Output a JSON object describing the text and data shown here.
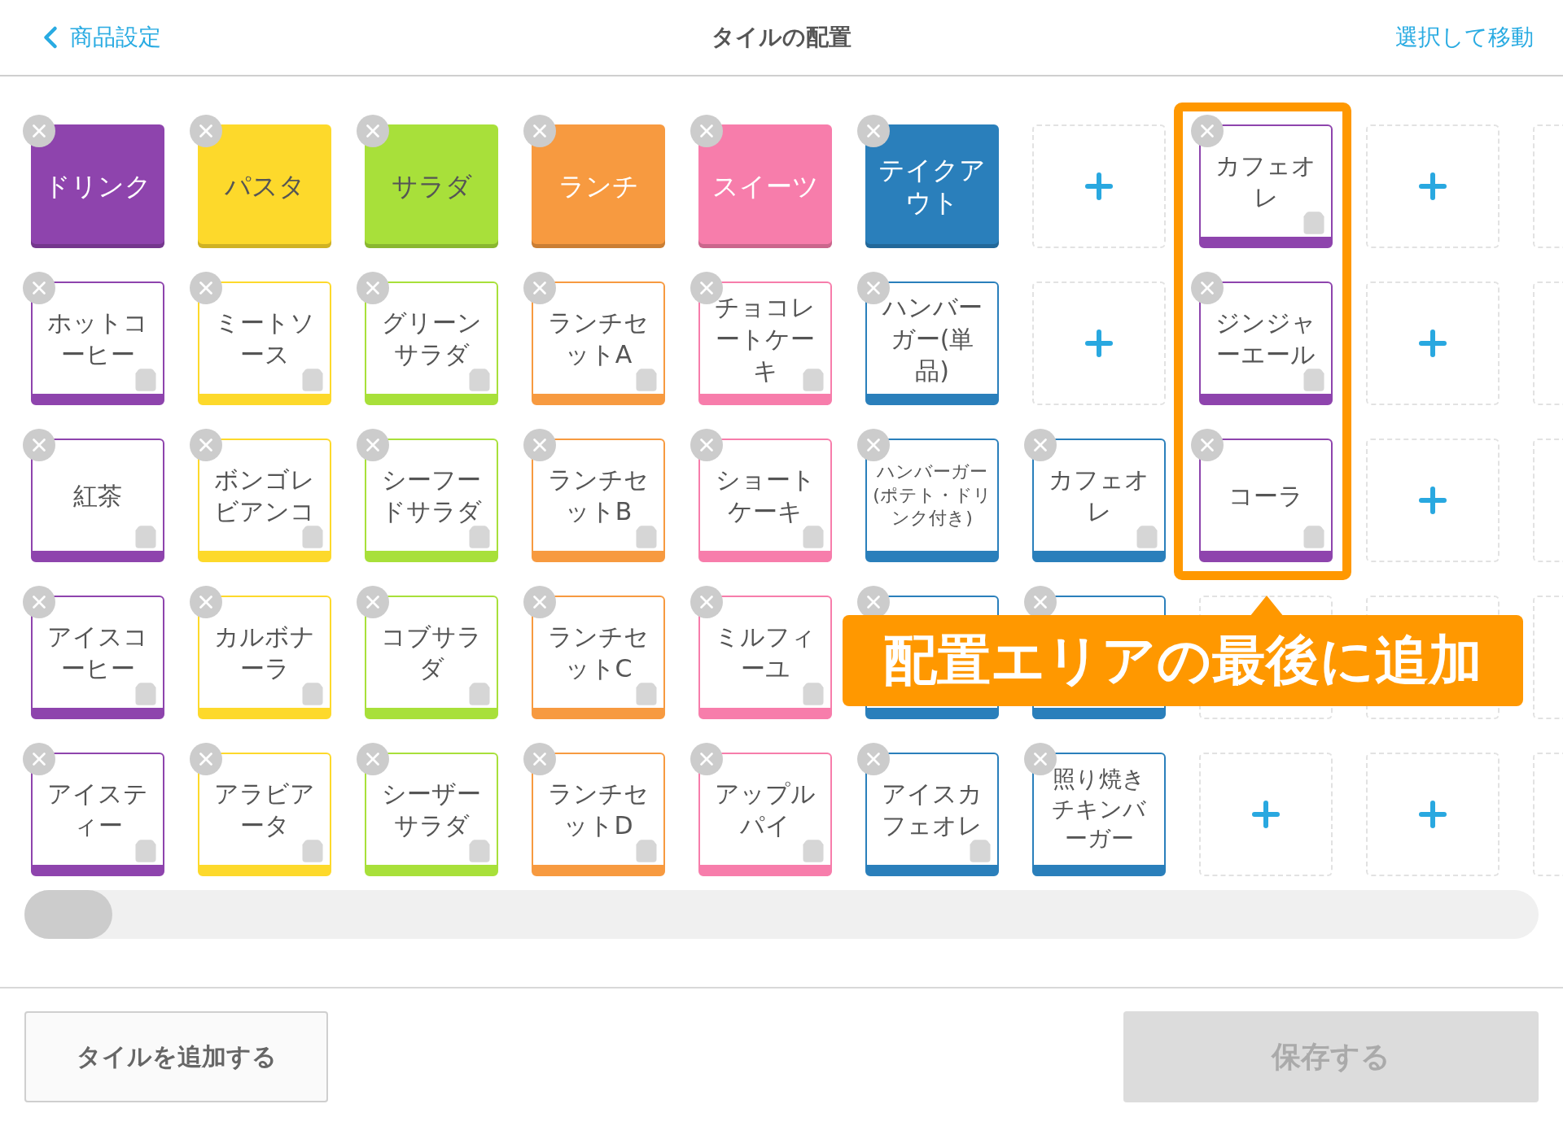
{
  "header": {
    "back_label": "商品設定",
    "title": "タイルの配置",
    "action": "選択して移動"
  },
  "grid": [
    {
      "cells": [
        {
          "kind": "category",
          "label": "ドリンク",
          "color": "#8e44ad"
        },
        {
          "kind": "category",
          "label": "パスタ",
          "color": "#fdd92b"
        },
        {
          "kind": "category",
          "label": "サラダ",
          "color": "#a8e03a"
        },
        {
          "kind": "category",
          "label": "ランチ",
          "color": "#f79a40"
        },
        {
          "kind": "category",
          "label": "スイーツ",
          "color": "#f77dab"
        },
        {
          "kind": "category",
          "label": "テイクアウト",
          "color": "#2a7fbb"
        },
        {
          "kind": "add"
        },
        {
          "kind": "item",
          "label": "カフェオレ",
          "color": "#8e44ad",
          "bag": true
        },
        {
          "kind": "add"
        },
        {
          "kind": "empty"
        }
      ]
    },
    {
      "cells": [
        {
          "kind": "item",
          "label": "ホットコーヒー",
          "color": "#8e44ad",
          "bag": true
        },
        {
          "kind": "item",
          "label": "ミートソース",
          "color": "#fdd92b",
          "bag": true
        },
        {
          "kind": "item",
          "label": "グリーンサラダ",
          "color": "#a8e03a",
          "bag": true
        },
        {
          "kind": "item",
          "label": "ランチセットA",
          "color": "#f79a40",
          "bag": true
        },
        {
          "kind": "item",
          "label": "チョコレートケーキ",
          "color": "#f77dab",
          "bag": true
        },
        {
          "kind": "item",
          "label": "ハンバーガー(単品)",
          "color": "#2a7fbb",
          "bag": false
        },
        {
          "kind": "add"
        },
        {
          "kind": "item",
          "label": "ジンジャーエール",
          "color": "#8e44ad",
          "bag": true
        },
        {
          "kind": "add"
        },
        {
          "kind": "empty"
        }
      ]
    },
    {
      "cells": [
        {
          "kind": "item",
          "label": "紅茶",
          "color": "#8e44ad",
          "bag": true
        },
        {
          "kind": "item",
          "label": "ボンゴレビアンコ",
          "color": "#fdd92b",
          "bag": true
        },
        {
          "kind": "item",
          "label": "シーフードサラダ",
          "color": "#a8e03a",
          "bag": true
        },
        {
          "kind": "item",
          "label": "ランチセットB",
          "color": "#f79a40",
          "bag": true
        },
        {
          "kind": "item",
          "label": "ショートケーキ",
          "color": "#f77dab",
          "bag": true
        },
        {
          "kind": "item",
          "label": "ハンバーガー(ポテト・ドリンク付き)",
          "color": "#2a7fbb",
          "bag": false
        },
        {
          "kind": "item",
          "label": "カフェオレ",
          "color": "#2a7fbb",
          "bag": true
        },
        {
          "kind": "item",
          "label": "コーラ",
          "color": "#8e44ad",
          "bag": true
        },
        {
          "kind": "add"
        },
        {
          "kind": "empty"
        }
      ]
    },
    {
      "cells": [
        {
          "kind": "item",
          "label": "アイスコーヒー",
          "color": "#8e44ad",
          "bag": true
        },
        {
          "kind": "item",
          "label": "カルボナーラ",
          "color": "#fdd92b",
          "bag": true
        },
        {
          "kind": "item",
          "label": "コブサラダ",
          "color": "#a8e03a",
          "bag": true
        },
        {
          "kind": "item",
          "label": "ランチセットC",
          "color": "#f79a40",
          "bag": true
        },
        {
          "kind": "item",
          "label": "ミルフィーユ",
          "color": "#f77dab",
          "bag": true
        },
        {
          "kind": "covered",
          "color": "#2a7fbb"
        },
        {
          "kind": "covered",
          "color": "#2a7fbb"
        },
        {
          "kind": "empty"
        },
        {
          "kind": "empty"
        },
        {
          "kind": "empty"
        }
      ]
    },
    {
      "cells": [
        {
          "kind": "item",
          "label": "アイスティー",
          "color": "#8e44ad",
          "bag": true
        },
        {
          "kind": "item",
          "label": "アラビアータ",
          "color": "#fdd92b",
          "bag": true
        },
        {
          "kind": "item",
          "label": "シーザーサラダ",
          "color": "#a8e03a",
          "bag": true
        },
        {
          "kind": "item",
          "label": "ランチセットD",
          "color": "#f79a40",
          "bag": true
        },
        {
          "kind": "item",
          "label": "アップルパイ",
          "color": "#f77dab",
          "bag": true
        },
        {
          "kind": "item",
          "label": "アイスカフェオレ",
          "color": "#2a7fbb",
          "bag": true
        },
        {
          "kind": "item",
          "label": "照り焼きチキンバーガー",
          "color": "#2a7fbb",
          "bag": false
        },
        {
          "kind": "add"
        },
        {
          "kind": "add"
        },
        {
          "kind": "empty"
        }
      ]
    }
  ],
  "callout": {
    "text": "配置エリアの最後に追加"
  },
  "footer": {
    "add_button": "タイルを追加する",
    "save_button": {
      "label": "保存する",
      "disabled": true
    }
  }
}
